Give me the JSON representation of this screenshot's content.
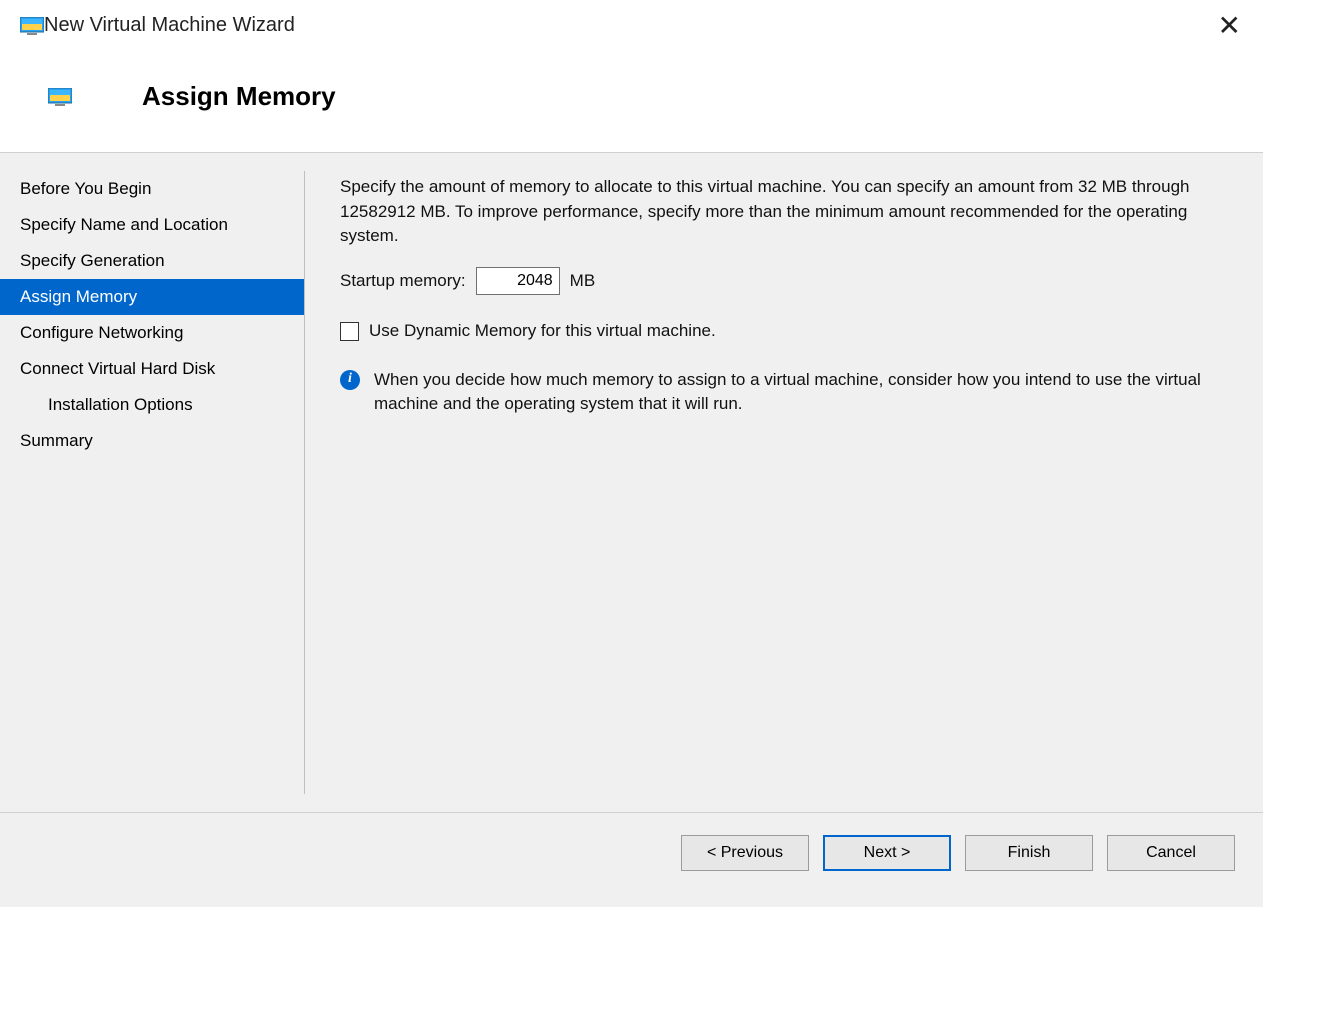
{
  "window": {
    "title": "New Virtual Machine Wizard",
    "page_title": "Assign Memory"
  },
  "sidebar": {
    "items": [
      {
        "label": "Before You Begin",
        "indent": false,
        "active": false
      },
      {
        "label": "Specify Name and Location",
        "indent": false,
        "active": false
      },
      {
        "label": "Specify Generation",
        "indent": false,
        "active": false
      },
      {
        "label": "Assign Memory",
        "indent": false,
        "active": true
      },
      {
        "label": "Configure Networking",
        "indent": false,
        "active": false
      },
      {
        "label": "Connect Virtual Hard Disk",
        "indent": false,
        "active": false
      },
      {
        "label": "Installation Options",
        "indent": true,
        "active": false
      },
      {
        "label": "Summary",
        "indent": false,
        "active": false
      }
    ]
  },
  "content": {
    "description": "Specify the amount of memory to allocate to this virtual machine. You can specify an amount from 32 MB through 12582912 MB. To improve performance, specify more than the minimum amount recommended for the operating system.",
    "startup_label": "Startup memory:",
    "startup_value": "2048",
    "startup_unit": "MB",
    "checkbox_label": "Use Dynamic Memory for this virtual machine.",
    "checkbox_checked": false,
    "info_text": "When you decide how much memory to assign to a virtual machine, consider how you intend to use the virtual machine and the operating system that it will run."
  },
  "footer": {
    "previous": "< Previous",
    "next": "Next >",
    "finish": "Finish",
    "cancel": "Cancel"
  }
}
